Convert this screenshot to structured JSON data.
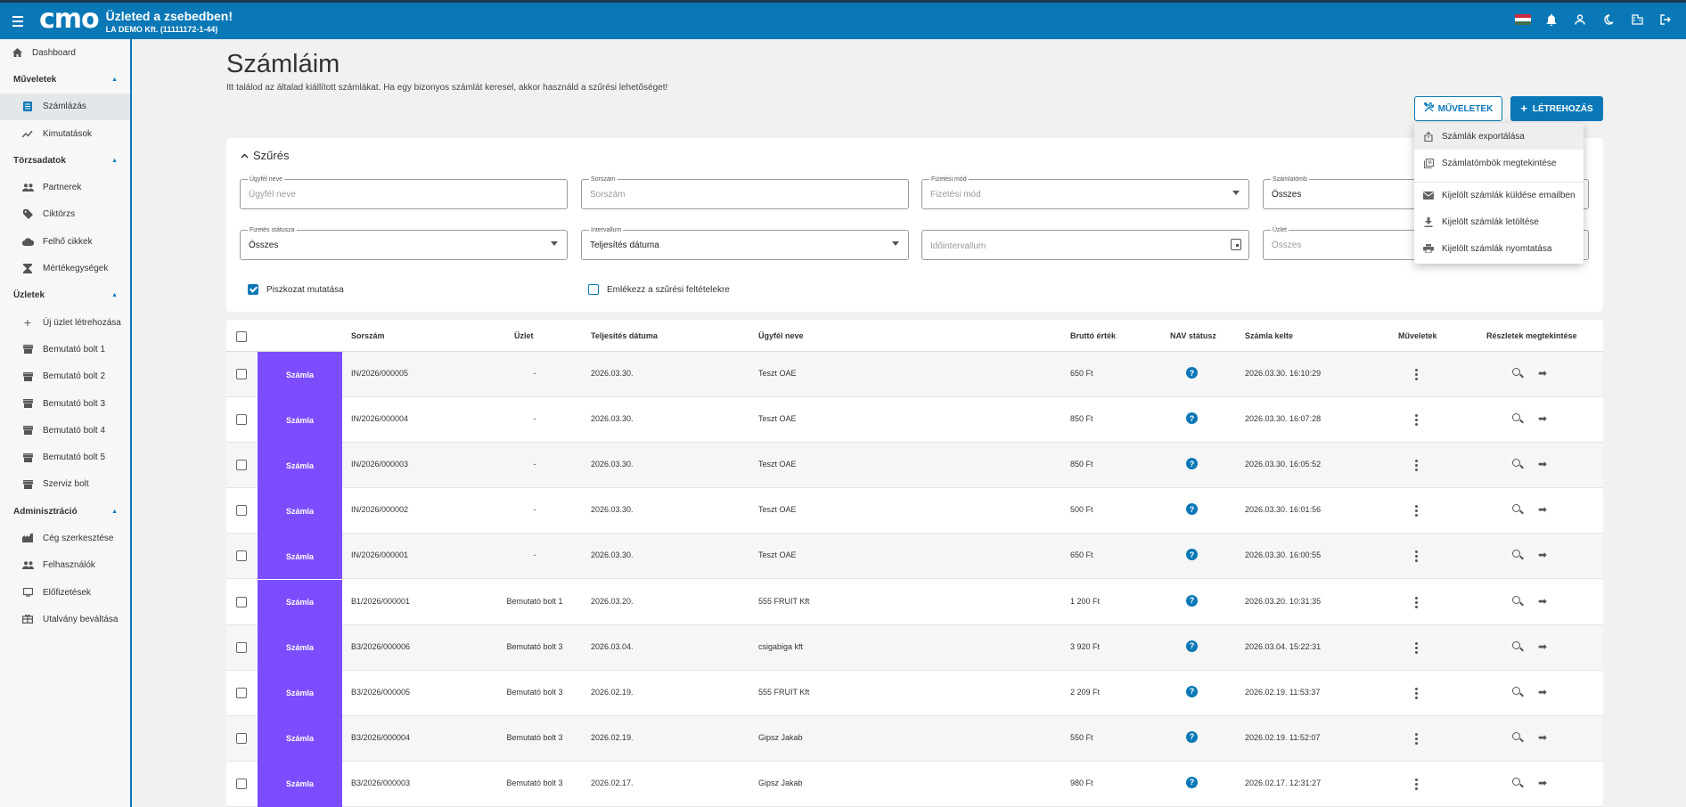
{
  "header": {
    "logo": "cmo",
    "title": "Üzleted a zsebedben!",
    "company": "LA DEMO Kft. (11111172-1-44)",
    "icons": [
      "hungarian-flag",
      "bell-icon",
      "user-icon",
      "moon-icon",
      "company-icon",
      "logout-icon"
    ]
  },
  "sidebar": {
    "dashboard": "Dashboard",
    "sections": [
      {
        "title": "Műveletek",
        "items": [
          "Számlázás",
          "Kimutatások"
        ]
      },
      {
        "title": "Törzsadatok",
        "items": [
          "Partnerek",
          "Ciktörzs",
          "Felhő cikkek",
          "Mértékegységek"
        ]
      },
      {
        "title": "Üzletek",
        "items": [
          "Új üzlet létrehozása",
          "Bemutató bolt 1",
          "Bemutató bolt 2",
          "Bemutató bolt 3",
          "Bemutató bolt 4",
          "Bemutató bolt 5",
          "Szerviz bolt"
        ]
      },
      {
        "title": "Adminisztráció",
        "items": [
          "Cég szerkesztése",
          "Felhasználók",
          "Előfizetések",
          "Utalvány beváltása"
        ]
      }
    ]
  },
  "page": {
    "title": "Számláim",
    "description": "Itt találod az általad kiállított számlákat. Ha egy bizonyos számlát keresel, akkor használd a szűrési lehetőséget!",
    "ops_button": "MŰVELETEK",
    "create_button": "LÉTREHOZÁS"
  },
  "filter": {
    "title": "Szűrés",
    "customer": {
      "label": "Ügyfél neve",
      "placeholder": "Ügyfél neve"
    },
    "serial": {
      "label": "Sorszám",
      "placeholder": "Sorszám"
    },
    "payment_method": {
      "label": "Fizetési mód",
      "placeholder": "Fizetési mód"
    },
    "invoice_block": {
      "label": "Számlatömb",
      "value": "Összes"
    },
    "payment_status": {
      "label": "Fizetés státusza",
      "value": "Összes"
    },
    "interval": {
      "label": "Intervallum",
      "value": "Teljesítés dátuma"
    },
    "time_interval": {
      "placeholder": "Időintervallum"
    },
    "shop": {
      "label": "Üzlet",
      "placeholder": "Összes"
    },
    "show_drafts": "Piszkozat mutatása",
    "remember_filters": "Emlékezz a szűrési feltételekre"
  },
  "table": {
    "headers": {
      "serial": "Sorszám",
      "shop": "Üzlet",
      "fulfillment": "Teljesítés dátuma",
      "customer": "Ügyfél neve",
      "gross": "Bruttó érték",
      "nav": "NAV státusz",
      "issued": "Számla kelte",
      "actions": "Műveletek",
      "details": "Részletek megtekintése"
    },
    "rows": [
      {
        "type": "Számla",
        "serial": "IN/2026/000005",
        "shop": "-",
        "fulfillment": "2026.03.30.",
        "customer": "Teszt OAE",
        "gross": "650 Ft",
        "nav": "?",
        "issued": "2026.03.30. 16:10:29"
      },
      {
        "type": "Számla",
        "serial": "IN/2026/000004",
        "shop": "-",
        "fulfillment": "2026.03.30.",
        "customer": "Teszt OAE",
        "gross": "850 Ft",
        "nav": "?",
        "issued": "2026.03.30. 16:07:28"
      },
      {
        "type": "Számla",
        "serial": "IN/2026/000003",
        "shop": "-",
        "fulfillment": "2026.03.30.",
        "customer": "Teszt OAE",
        "gross": "850 Ft",
        "nav": "?",
        "issued": "2026.03.30. 16:05:52"
      },
      {
        "type": "Számla",
        "serial": "IN/2026/000002",
        "shop": "-",
        "fulfillment": "2026.03.30.",
        "customer": "Teszt OAE",
        "gross": "500 Ft",
        "nav": "?",
        "issued": "2026.03.30. 16:01:56"
      },
      {
        "type": "Számla",
        "serial": "IN/2026/000001",
        "shop": "-",
        "fulfillment": "2026.03.30.",
        "customer": "Teszt OAE",
        "gross": "650 Ft",
        "nav": "?",
        "issued": "2026.03.30. 16:00:55"
      },
      {
        "type": "Számla",
        "serial": "B1/2026/000001",
        "shop": "Bemutató bolt 1",
        "fulfillment": "2026.03.20.",
        "customer": "555 FRUIT Kft",
        "gross": "1 200 Ft",
        "nav": "?",
        "issued": "2026.03.20. 10:31:35"
      },
      {
        "type": "Számla",
        "serial": "B3/2026/000006",
        "shop": "Bemutató bolt 3",
        "fulfillment": "2026.03.04.",
        "customer": "csigabiga kft",
        "gross": "3 920 Ft",
        "nav": "?",
        "issued": "2026.03.04. 15:22:31"
      },
      {
        "type": "Számla",
        "serial": "B3/2026/000005",
        "shop": "Bemutató bolt 3",
        "fulfillment": "2026.02.19.",
        "customer": "555 FRUIT Kft",
        "gross": "2 209 Ft",
        "nav": "?",
        "issued": "2026.02.19. 11:53:37"
      },
      {
        "type": "Számla",
        "serial": "B3/2026/000004",
        "shop": "Bemutató bolt 3",
        "fulfillment": "2026.02.19.",
        "customer": "Gipsz Jakab",
        "gross": "550 Ft",
        "nav": "?",
        "issued": "2026.02.19. 11:52:07"
      },
      {
        "type": "Számla",
        "serial": "B3/2026/000003",
        "shop": "Bemutató bolt 3",
        "fulfillment": "2026.02.17.",
        "customer": "Gipsz Jakab",
        "gross": "980 Ft",
        "nav": "?",
        "issued": "2026.02.17. 12:31:27"
      }
    ]
  },
  "menu": {
    "items": [
      "Számlák exportálása",
      "Számlatömbök megtekintése",
      "Kijelölt számlák küldése emailben",
      "Kijelölt számlák letöltése",
      "Kijelölt számlák nyomtatása"
    ]
  },
  "colors": {
    "primary": "#0a78b7",
    "badge": "#7c4dff"
  }
}
